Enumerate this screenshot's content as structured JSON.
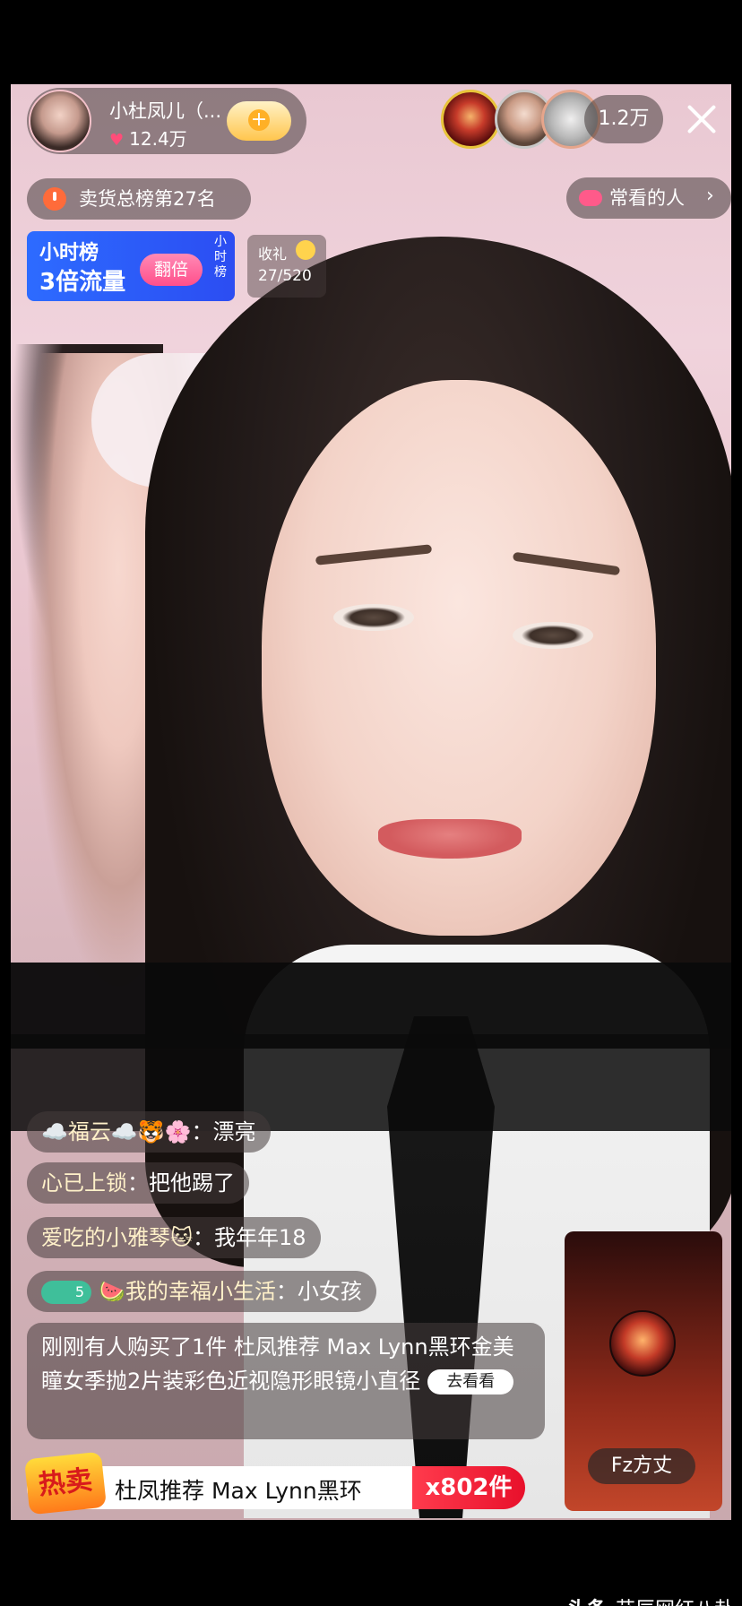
{
  "host": {
    "name": "小杜凤儿（...",
    "likes": "12.4万"
  },
  "viewers": {
    "count": "1.2万"
  },
  "badges": {
    "sales_rank": "卖货总榜第27名",
    "frequent_viewers": "常看的人"
  },
  "hour_board": {
    "line1": "小时榜",
    "line2": "3倍流量",
    "button": "翻倍",
    "side_label": "小时榜"
  },
  "gift": {
    "title": "收礼",
    "progress": "27/520"
  },
  "comments": [
    {
      "nick": "☁️福云☁️🐯🌸",
      "text": "漂亮"
    },
    {
      "nick": "心已上锁",
      "text": "把他踢了"
    },
    {
      "nick": "爱吃的小雅琴🐱",
      "text": "我年年18"
    },
    {
      "nick": "🍉我的幸福小生活",
      "text": "小女孩",
      "level": "5"
    }
  ],
  "purchase": {
    "text": "刚刚有人购买了1件 杜凤推荐 Max Lynn黑环金美瞳女季抛2片装彩色近视隐形眼镜小直径",
    "button": "去看看"
  },
  "hot_product": {
    "badge": "热卖",
    "name": "杜凤推荐 Max Lynn黑环",
    "count": "x802件"
  },
  "pk_user": {
    "name": "Fz方丈"
  },
  "watermark": {
    "brand": "头条",
    "author": "艾辰网红八卦"
  }
}
